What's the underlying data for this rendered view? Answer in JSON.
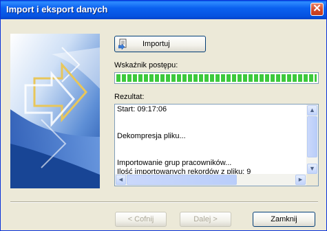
{
  "window": {
    "title": "Import i eksport danych"
  },
  "import_button": {
    "label": "Importuj",
    "icon": "import-icon"
  },
  "progress": {
    "label": "Wskaźnik postępu:",
    "value_fraction": 1.0,
    "color": "#3dc93d"
  },
  "result": {
    "label": "Rezultat:",
    "lines": [
      "Start: 09:17:06",
      "",
      "",
      "Dekompresja pliku...",
      "",
      "",
      "Importowanie grup pracowników...",
      "Ilość importowanych rekordów z pliku: 9"
    ]
  },
  "scrollbars": {
    "up": "▲",
    "down": "▼",
    "left": "◄",
    "right": "►"
  },
  "footer": {
    "prev_label": "< Cofnij",
    "next_label": "Dalej >",
    "close_label": "Zamknij"
  },
  "colors": {
    "titlebar": "#0552e0",
    "dialog_bg": "#ece9d8",
    "close_btn": "#d2492a"
  }
}
